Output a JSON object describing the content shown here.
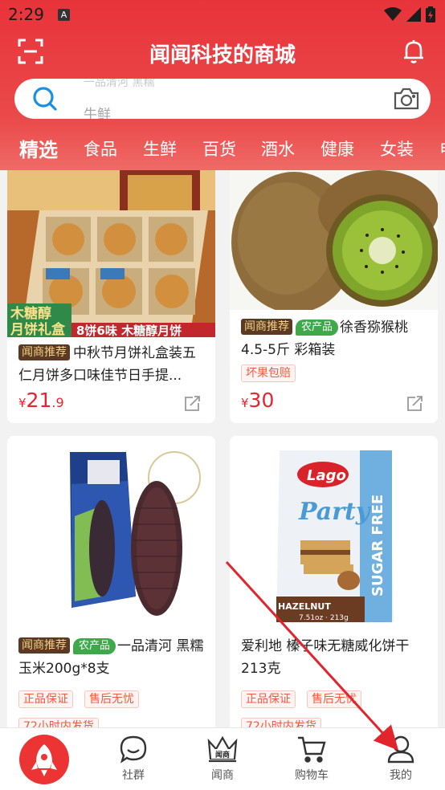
{
  "status_bar": {
    "time": "2:29",
    "notif_letter": "A"
  },
  "header": {
    "title": "闻闻科技的商城"
  },
  "search": {
    "ghost_text": "一品清河 黑糯",
    "placeholder": "牛鲜"
  },
  "tabs": [
    "精选",
    "食品",
    "生鲜",
    "百货",
    "酒水",
    "健康",
    "女装",
    "电"
  ],
  "products": [
    {
      "badge": "闻商推荐",
      "title": "中秋节月饼礼盒装五仁月饼多口味佳节日手提...",
      "price_symbol": "¥",
      "price_int": "21",
      "price_dec": ".9",
      "image_caption_1": "木糖醇",
      "image_caption_2": "月饼礼盒",
      "image_caption_3": "8饼6味 木糖醇月饼"
    },
    {
      "badge": "闻商推荐",
      "badge2": "农产品",
      "title": "徐香猕猴桃4.5-5斤 彩箱装",
      "tags": [
        "坏果包赔"
      ],
      "price_symbol": "¥",
      "price_int": "30",
      "price_dec": ""
    },
    {
      "badge": "闻商推荐",
      "badge2": "农产品",
      "title": "一品清河 黑糯玉米200g*8支",
      "tags": [
        "正品保证",
        "售后无忧",
        "72小时内发货"
      ]
    },
    {
      "title": "爱利地 榛子味无糖威化饼干213克",
      "tags": [
        "正品保证",
        "售后无忧",
        "72小时内发货"
      ],
      "image_brand": "Lago",
      "image_product": "Party",
      "image_side": "SUGAR FREE",
      "image_flavor": "HAZELNUT",
      "image_weight": "7.51oz · 213g"
    }
  ],
  "bottom_nav": [
    {
      "label": "社群",
      "icon": "chat-icon"
    },
    {
      "label": "闻商",
      "icon": "crown-icon",
      "icon_text": "闻商"
    },
    {
      "label": "购物车",
      "icon": "cart-icon"
    },
    {
      "label": "我的",
      "icon": "user-icon"
    }
  ],
  "colors": {
    "brand_red": "#e8333a",
    "price_red": "#e8232e",
    "badge_dark": "#5a3a22",
    "badge_gold": "#f6cf86",
    "farm_green": "#3ea84a"
  }
}
